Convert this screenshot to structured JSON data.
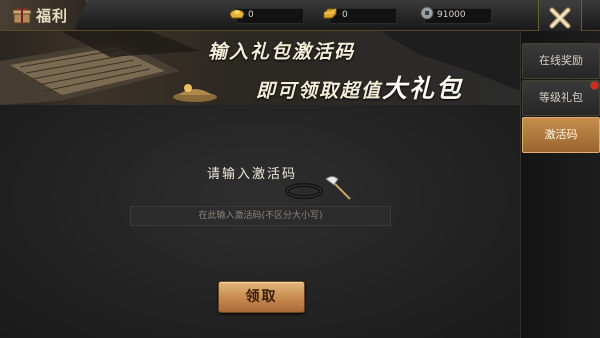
{
  "header": {
    "title": "福利",
    "resources": [
      {
        "icon": "gold-ingot-icon",
        "value": "0"
      },
      {
        "icon": "gold-bar-icon",
        "value": "0"
      },
      {
        "icon": "copper-coin-icon",
        "value": "91000"
      }
    ]
  },
  "banner": {
    "line1": "输入礼包激活码",
    "line2_prefix": "即可领取超值",
    "line2_highlight": "大礼包"
  },
  "redeem": {
    "prompt": "请输入激活码",
    "placeholder": "在此输入激活码(不区分大小写)",
    "value": "",
    "button_label": "领取"
  },
  "sidebar": {
    "tabs": [
      {
        "label": "在线奖励",
        "active": false,
        "badge": false
      },
      {
        "label": "等级礼包",
        "active": false,
        "badge": true
      },
      {
        "label": "激活码",
        "active": true,
        "badge": false
      }
    ]
  },
  "colors": {
    "accent": "#c58e4e",
    "badge_red": "#d42a1a",
    "text_light": "#efe9dc"
  }
}
